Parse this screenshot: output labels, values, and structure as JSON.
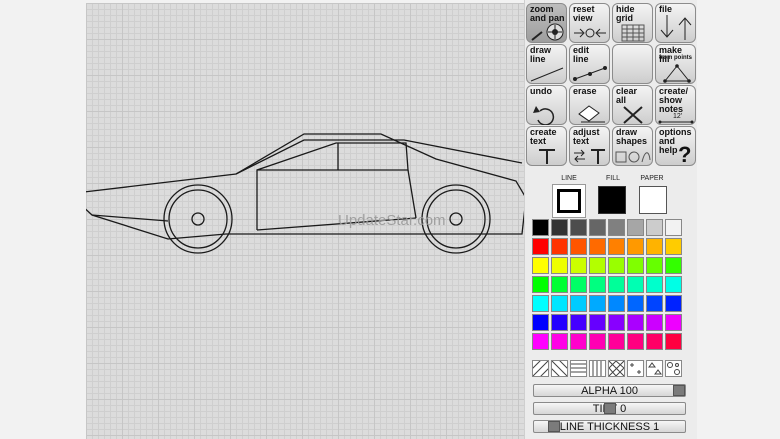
{
  "watermark": "UpdateStar.com",
  "tools": [
    {
      "name": "zoom-and-pan-button",
      "lines": [
        "zoom",
        "and pan"
      ],
      "icon": "zoom-pan-icon",
      "active": true
    },
    {
      "name": "reset-view-button",
      "lines": [
        "reset",
        "view"
      ],
      "icon": "reset-view-icon"
    },
    {
      "name": "hide-grid-button",
      "lines": [
        "hide",
        "grid"
      ],
      "icon": "grid-icon"
    },
    {
      "name": "file-button",
      "lines": [
        "file"
      ],
      "icon": "file-arrows-icon"
    },
    {
      "name": "draw-line-button",
      "lines": [
        "draw",
        "line"
      ],
      "icon": "line-icon"
    },
    {
      "name": "edit-line-button",
      "lines": [
        "edit",
        "line"
      ],
      "icon": "edit-line-icon"
    },
    {
      "name": "blank-tool-button",
      "lines": [],
      "icon": "none"
    },
    {
      "name": "make-fill-button",
      "lines": [
        "make fill"
      ],
      "small": "from points",
      "icon": "fill-points-icon"
    },
    {
      "name": "undo-button",
      "lines": [
        "undo"
      ],
      "icon": "undo-icon"
    },
    {
      "name": "erase-button",
      "lines": [
        "erase"
      ],
      "icon": "eraser-icon"
    },
    {
      "name": "clear-all-button",
      "lines": [
        "clear",
        "all"
      ],
      "icon": "clear-x-icon"
    },
    {
      "name": "create-show-notes-button",
      "lines": [
        "create/",
        "show",
        "notes"
      ],
      "icon": "notes-icon",
      "note": "12'"
    },
    {
      "name": "create-text-button",
      "lines": [
        "create",
        "text"
      ],
      "icon": "text-icon"
    },
    {
      "name": "adjust-text-button",
      "lines": [
        "adjust",
        "text"
      ],
      "icon": "adjust-text-icon"
    },
    {
      "name": "draw-shapes-button",
      "lines": [
        "draw",
        "shapes"
      ],
      "icon": "shapes-icon"
    },
    {
      "name": "options-help-button",
      "lines": [
        "options",
        "and",
        "help"
      ],
      "icon": "help-icon"
    }
  ],
  "swatches": {
    "line_label": "LINE",
    "fill_label": "FILL",
    "paper_label": "PAPER",
    "line_color": "#ffffff",
    "fill_color": "#000000",
    "paper_color": "#ffffff"
  },
  "palette": [
    "#000000",
    "#333333",
    "#4d4d4d",
    "#666666",
    "#808080",
    "#a6a6a6",
    "#cccccc",
    "#f2f2f2",
    "#ff0000",
    "#ff3300",
    "#ff5500",
    "#ff6a00",
    "#ff8000",
    "#ff9900",
    "#ffb300",
    "#ffcc00",
    "#ffff00",
    "#eeff00",
    "#ccff00",
    "#b3ff00",
    "#99ff00",
    "#80ff00",
    "#66ff00",
    "#33ff00",
    "#00ff00",
    "#00ff33",
    "#00ff66",
    "#00ff80",
    "#00ff99",
    "#00ffb3",
    "#00ffcc",
    "#00ffe6",
    "#00ffff",
    "#00e6ff",
    "#00ccff",
    "#00aaff",
    "#0088ff",
    "#0066ff",
    "#0044ff",
    "#0022ff",
    "#0000ff",
    "#2200ff",
    "#4400ff",
    "#6600ff",
    "#8800ff",
    "#aa00ff",
    "#cc00ff",
    "#ee00ff",
    "#ff00ff",
    "#ff00e6",
    "#ff00cc",
    "#ff00b3",
    "#ff0099",
    "#ff0080",
    "#ff0066",
    "#ff0040"
  ],
  "patterns": [
    "hatch-diag-a",
    "hatch-diag-b",
    "hatch-horizontal",
    "hatch-vertical",
    "crosshatch",
    "plus-pattern",
    "triangles-pattern",
    "circles-pattern"
  ],
  "sliders": {
    "alpha": "ALPHA 100",
    "alpha_value": 1.0,
    "tint": "TINT 0",
    "tint_value": 0.5,
    "thickness": "LINE THICKNESS 1",
    "thickness_value": 0.0
  }
}
